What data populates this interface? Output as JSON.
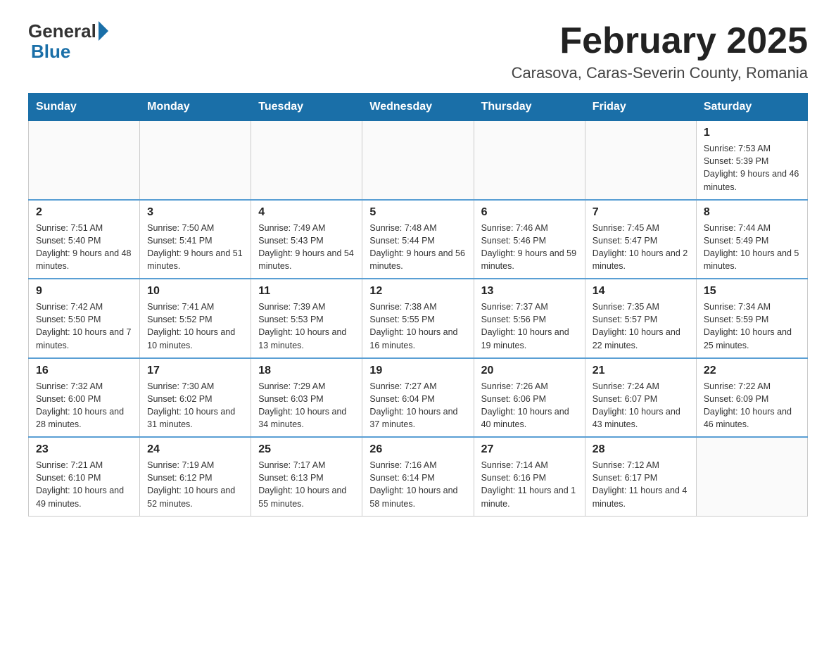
{
  "header": {
    "logo_general": "General",
    "logo_blue": "Blue",
    "month_title": "February 2025",
    "location": "Carasova, Caras-Severin County, Romania"
  },
  "weekdays": [
    "Sunday",
    "Monday",
    "Tuesday",
    "Wednesday",
    "Thursday",
    "Friday",
    "Saturday"
  ],
  "weeks": [
    [
      {
        "day": "",
        "info": ""
      },
      {
        "day": "",
        "info": ""
      },
      {
        "day": "",
        "info": ""
      },
      {
        "day": "",
        "info": ""
      },
      {
        "day": "",
        "info": ""
      },
      {
        "day": "",
        "info": ""
      },
      {
        "day": "1",
        "info": "Sunrise: 7:53 AM\nSunset: 5:39 PM\nDaylight: 9 hours and 46 minutes."
      }
    ],
    [
      {
        "day": "2",
        "info": "Sunrise: 7:51 AM\nSunset: 5:40 PM\nDaylight: 9 hours and 48 minutes."
      },
      {
        "day": "3",
        "info": "Sunrise: 7:50 AM\nSunset: 5:41 PM\nDaylight: 9 hours and 51 minutes."
      },
      {
        "day": "4",
        "info": "Sunrise: 7:49 AM\nSunset: 5:43 PM\nDaylight: 9 hours and 54 minutes."
      },
      {
        "day": "5",
        "info": "Sunrise: 7:48 AM\nSunset: 5:44 PM\nDaylight: 9 hours and 56 minutes."
      },
      {
        "day": "6",
        "info": "Sunrise: 7:46 AM\nSunset: 5:46 PM\nDaylight: 9 hours and 59 minutes."
      },
      {
        "day": "7",
        "info": "Sunrise: 7:45 AM\nSunset: 5:47 PM\nDaylight: 10 hours and 2 minutes."
      },
      {
        "day": "8",
        "info": "Sunrise: 7:44 AM\nSunset: 5:49 PM\nDaylight: 10 hours and 5 minutes."
      }
    ],
    [
      {
        "day": "9",
        "info": "Sunrise: 7:42 AM\nSunset: 5:50 PM\nDaylight: 10 hours and 7 minutes."
      },
      {
        "day": "10",
        "info": "Sunrise: 7:41 AM\nSunset: 5:52 PM\nDaylight: 10 hours and 10 minutes."
      },
      {
        "day": "11",
        "info": "Sunrise: 7:39 AM\nSunset: 5:53 PM\nDaylight: 10 hours and 13 minutes."
      },
      {
        "day": "12",
        "info": "Sunrise: 7:38 AM\nSunset: 5:55 PM\nDaylight: 10 hours and 16 minutes."
      },
      {
        "day": "13",
        "info": "Sunrise: 7:37 AM\nSunset: 5:56 PM\nDaylight: 10 hours and 19 minutes."
      },
      {
        "day": "14",
        "info": "Sunrise: 7:35 AM\nSunset: 5:57 PM\nDaylight: 10 hours and 22 minutes."
      },
      {
        "day": "15",
        "info": "Sunrise: 7:34 AM\nSunset: 5:59 PM\nDaylight: 10 hours and 25 minutes."
      }
    ],
    [
      {
        "day": "16",
        "info": "Sunrise: 7:32 AM\nSunset: 6:00 PM\nDaylight: 10 hours and 28 minutes."
      },
      {
        "day": "17",
        "info": "Sunrise: 7:30 AM\nSunset: 6:02 PM\nDaylight: 10 hours and 31 minutes."
      },
      {
        "day": "18",
        "info": "Sunrise: 7:29 AM\nSunset: 6:03 PM\nDaylight: 10 hours and 34 minutes."
      },
      {
        "day": "19",
        "info": "Sunrise: 7:27 AM\nSunset: 6:04 PM\nDaylight: 10 hours and 37 minutes."
      },
      {
        "day": "20",
        "info": "Sunrise: 7:26 AM\nSunset: 6:06 PM\nDaylight: 10 hours and 40 minutes."
      },
      {
        "day": "21",
        "info": "Sunrise: 7:24 AM\nSunset: 6:07 PM\nDaylight: 10 hours and 43 minutes."
      },
      {
        "day": "22",
        "info": "Sunrise: 7:22 AM\nSunset: 6:09 PM\nDaylight: 10 hours and 46 minutes."
      }
    ],
    [
      {
        "day": "23",
        "info": "Sunrise: 7:21 AM\nSunset: 6:10 PM\nDaylight: 10 hours and 49 minutes."
      },
      {
        "day": "24",
        "info": "Sunrise: 7:19 AM\nSunset: 6:12 PM\nDaylight: 10 hours and 52 minutes."
      },
      {
        "day": "25",
        "info": "Sunrise: 7:17 AM\nSunset: 6:13 PM\nDaylight: 10 hours and 55 minutes."
      },
      {
        "day": "26",
        "info": "Sunrise: 7:16 AM\nSunset: 6:14 PM\nDaylight: 10 hours and 58 minutes."
      },
      {
        "day": "27",
        "info": "Sunrise: 7:14 AM\nSunset: 6:16 PM\nDaylight: 11 hours and 1 minute."
      },
      {
        "day": "28",
        "info": "Sunrise: 7:12 AM\nSunset: 6:17 PM\nDaylight: 11 hours and 4 minutes."
      },
      {
        "day": "",
        "info": ""
      }
    ]
  ]
}
